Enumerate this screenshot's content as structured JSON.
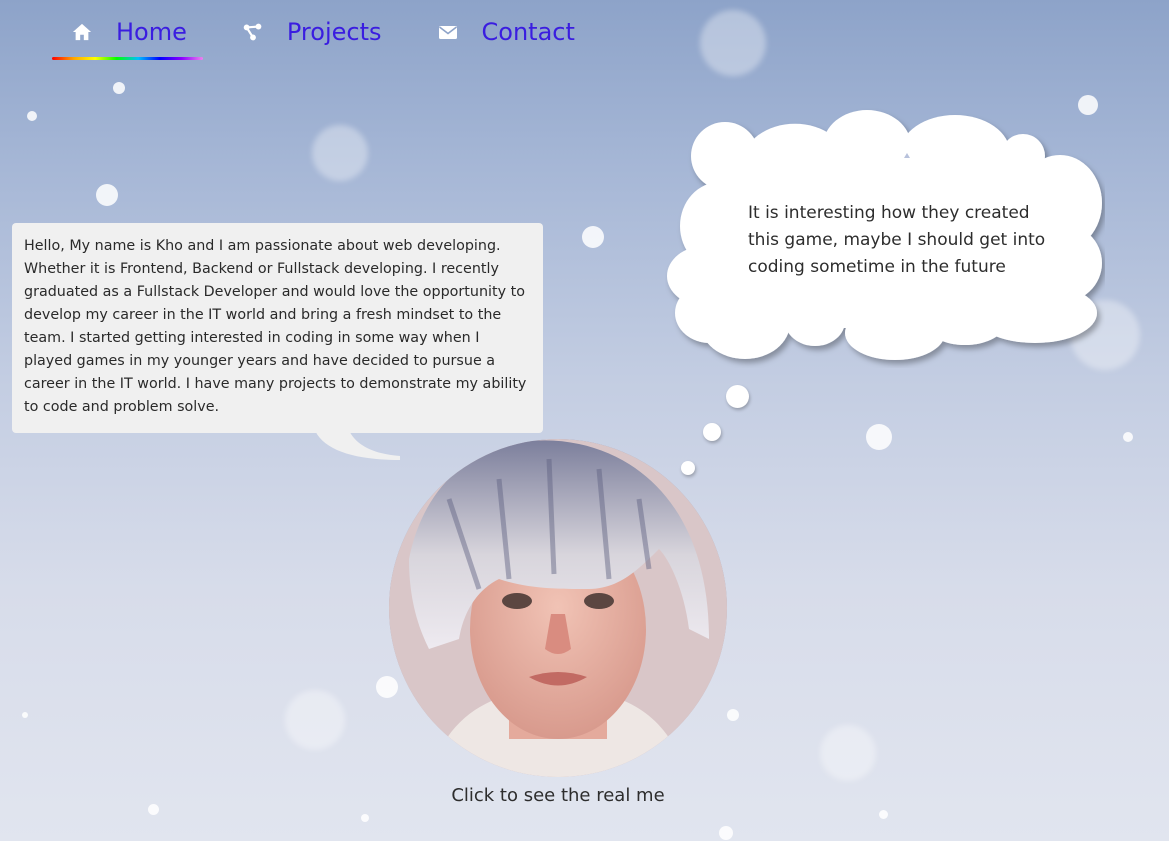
{
  "nav": {
    "items": [
      {
        "label": "Home",
        "icon": "home-icon",
        "active": true
      },
      {
        "label": "Projects",
        "icon": "share-nodes-icon",
        "active": false
      },
      {
        "label": "Contact",
        "icon": "envelope-icon",
        "active": false
      }
    ]
  },
  "intro": {
    "text": "Hello, My name is Kho and I am passionate about web developing. Whether it is Frontend, Backend or Fullstack developing. I recently graduated as a Fullstack Developer and would love the opportunity to develop my career in the IT world and bring a fresh mindset to the team. I started getting interested in coding in some way when I played games in my younger years and have decided to pursue a career in the IT world. I have many projects to demonstrate my ability to code and problem solve."
  },
  "thought": {
    "text": "It is interesting how they created this game, maybe I should get into coding sometime in the future"
  },
  "portrait": {
    "caption": "Click to see the real me"
  },
  "colors": {
    "nav_text": "#3a1de0",
    "bubble_bg": "#f0f0f0",
    "text": "#2d2d2d"
  }
}
